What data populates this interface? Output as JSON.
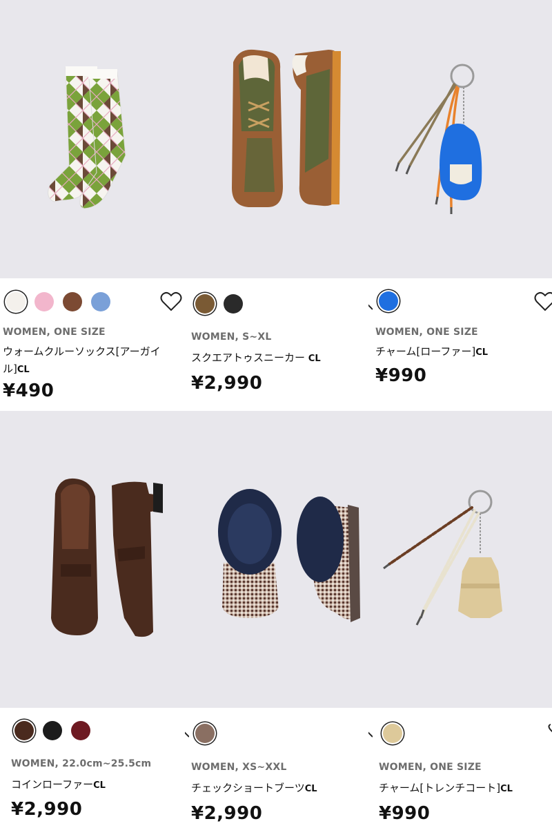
{
  "products": [
    {
      "meta": "WOMEN, ONE SIZE",
      "name": "ウォームクルーソックス[アーガイル]",
      "name_tag": "CL",
      "price": "¥490",
      "swatches": [
        "#f4f1ec",
        "#f2b6cc",
        "#7c4a33",
        "#7aa0d8"
      ],
      "swatch_selected": 0,
      "image": "argyle-socks-image"
    },
    {
      "meta": "WOMEN, S~XL",
      "name": "スクエアトゥスニーカー",
      "name_tag": "CL",
      "price": "¥2,990",
      "swatches": [
        "#7a5a34",
        "#2a2a2a"
      ],
      "swatch_selected": 0,
      "image": "square-toe-sneaker-image"
    },
    {
      "meta": "WOMEN, ONE SIZE",
      "name": "チャーム[ローファー]",
      "name_tag": "CL",
      "price": "¥990",
      "swatches": [
        "#1f6fe0"
      ],
      "swatch_selected": 0,
      "image": "loafer-charm-image"
    },
    {
      "meta": "WOMEN, 22.0cm~25.5cm",
      "name": "コインローファー",
      "name_tag": "CL",
      "price": "¥2,990",
      "swatches": [
        "#4a2a1e",
        "#1c1c1c",
        "#6e1a22"
      ],
      "swatch_selected": 0,
      "image": "coin-loafer-image"
    },
    {
      "meta": "WOMEN, XS~XXL",
      "name": "チェックショートブーツ",
      "name_tag": "CL",
      "price": "¥2,990",
      "swatches": [
        "#8a6f62"
      ],
      "swatch_selected": 0,
      "image": "check-short-boots-image"
    },
    {
      "meta": "WOMEN, ONE SIZE",
      "name": "チャーム[トレンチコート]",
      "name_tag": "CL",
      "price": "¥990",
      "swatches": [
        "#ddc99a"
      ],
      "swatch_selected": 0,
      "image": "trench-coat-charm-image"
    }
  ],
  "colors": {
    "image_bg": "#e8e7ec",
    "text": "#111111",
    "meta": "#6d6d6d"
  }
}
